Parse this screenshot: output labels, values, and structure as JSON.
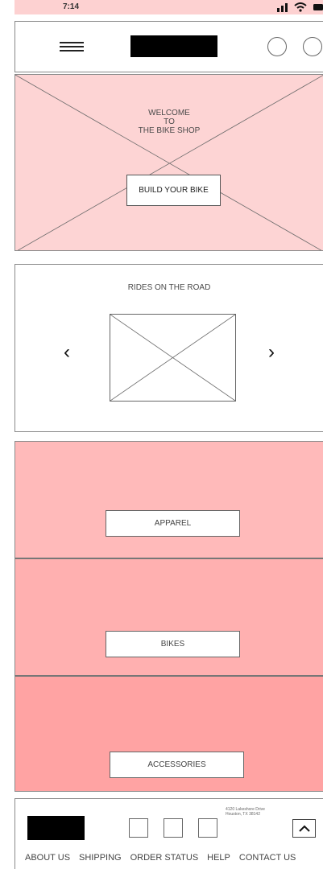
{
  "status_bar": {
    "time": "7:14"
  },
  "header": {
    "menu_icon": "hamburger-icon"
  },
  "hero": {
    "welcome_line1": "WELCOME",
    "welcome_line2": "TO",
    "welcome_line3": "THE BIKE SHOP",
    "cta_label": "BUILD YOUR BIKE"
  },
  "rides": {
    "title": "RIDES ON THE ROAD",
    "prev_glyph": "‹",
    "next_glyph": "›"
  },
  "categories": [
    {
      "label": "APPAREL",
      "color": "#ffbaba"
    },
    {
      "label": "BIKES",
      "color": "#ffb0b0"
    },
    {
      "label": "ACCESSORIES",
      "color": "#ffa3a3"
    }
  ],
  "footer": {
    "address_line1": "4120 Lakeshore Drive",
    "address_line2": "Houston, TX 38142",
    "links": [
      "ABOUT US",
      "SHIPPING",
      "ORDER STATUS",
      "HELP",
      "CONTACT US"
    ]
  },
  "colors": {
    "hero_bg": "#fdd4d4",
    "status_bg": "#fdd1d1"
  }
}
